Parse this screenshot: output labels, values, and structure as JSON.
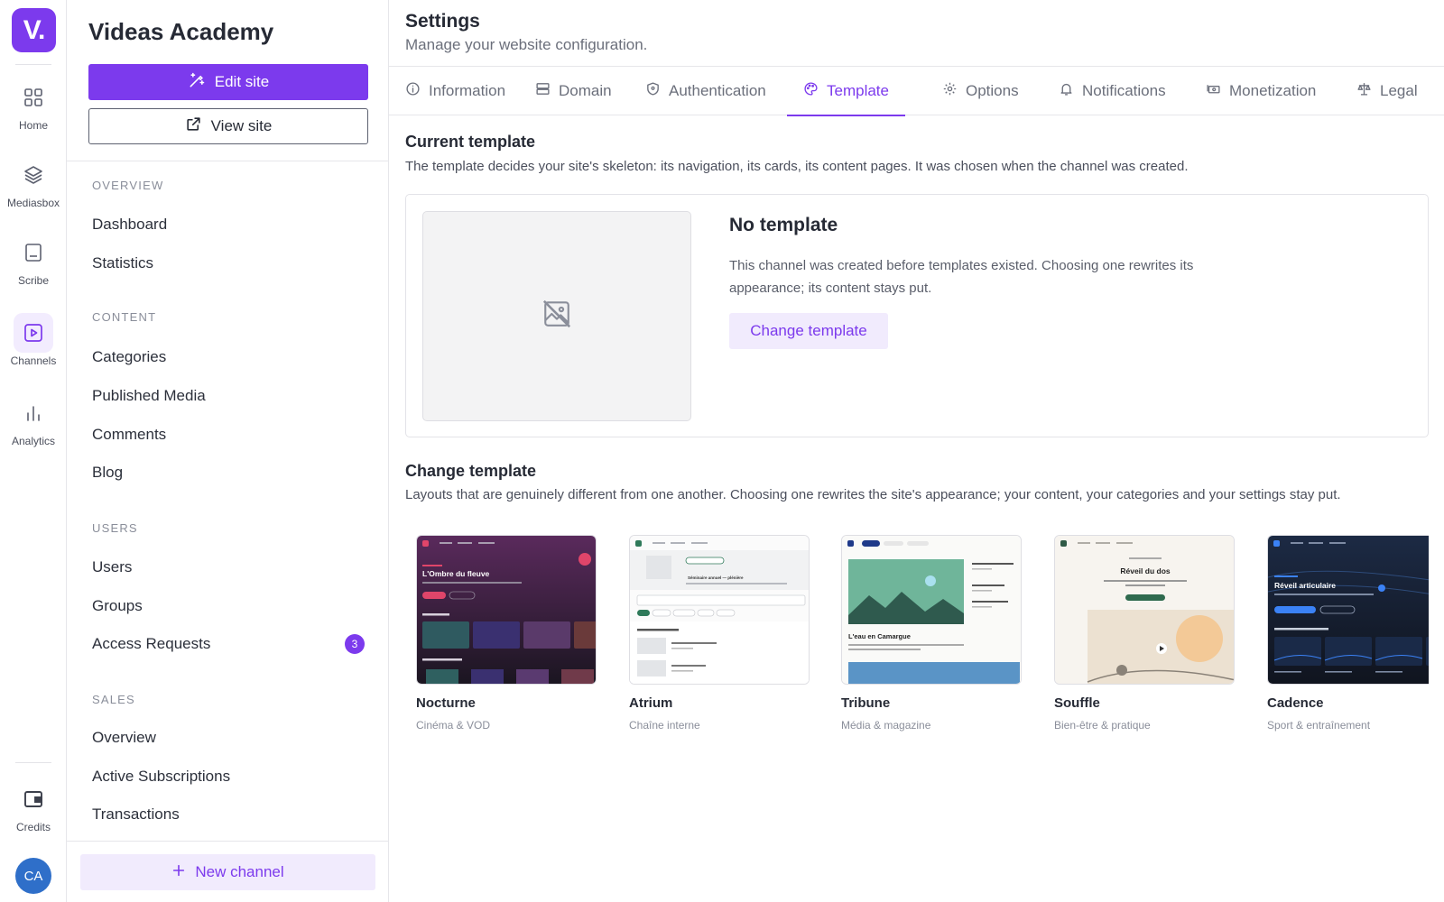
{
  "rail": {
    "logo": "V.",
    "items": [
      {
        "label": "Home",
        "icon": "grid-icon"
      },
      {
        "label": "Mediasbox",
        "icon": "layers-icon"
      },
      {
        "label": "Scribe",
        "icon": "document-icon"
      },
      {
        "label": "Channels",
        "icon": "play-square-icon",
        "active": true
      },
      {
        "label": "Analytics",
        "icon": "bar-chart-icon"
      }
    ],
    "credits_label": "Credits",
    "avatar_initials": "CA"
  },
  "sidebar": {
    "site_title": "Videas Academy",
    "edit_label": "Edit site",
    "view_label": "View site",
    "sections": {
      "overview": {
        "title": "OVERVIEW",
        "items": [
          "Dashboard",
          "Statistics"
        ]
      },
      "content": {
        "title": "CONTENT",
        "items": [
          "Categories",
          "Published Media",
          "Comments",
          "Blog"
        ]
      },
      "users": {
        "title": "USERS",
        "items": [
          "Users",
          "Groups",
          "Access Requests"
        ],
        "access_requests_badge": "3"
      },
      "sales": {
        "title": "SALES",
        "items": [
          "Overview",
          "Active Subscriptions",
          "Transactions"
        ]
      }
    },
    "new_channel_label": "New channel"
  },
  "header": {
    "title": "Settings",
    "subtitle": "Manage your website configuration."
  },
  "tabs": [
    {
      "label": "Information",
      "icon": "info-icon"
    },
    {
      "label": "Domain",
      "icon": "server-icon"
    },
    {
      "label": "Authentication",
      "icon": "shield-icon"
    },
    {
      "label": "Template",
      "icon": "palette-icon",
      "active": true
    },
    {
      "label": "Options",
      "icon": "gear-icon"
    },
    {
      "label": "Notifications",
      "icon": "bell-icon"
    },
    {
      "label": "Monetization",
      "icon": "money-icon"
    },
    {
      "label": "Legal",
      "icon": "scale-icon"
    }
  ],
  "current_template": {
    "title": "Current template",
    "description": "The template decides your site's skeleton: its navigation, its cards, its content pages. It was chosen when the channel was created.",
    "card_title": "No template",
    "card_description": "This channel was created before templates existed. Choosing one rewrites its appearance; its content stays put.",
    "change_button": "Change template"
  },
  "change_template": {
    "title": "Change template",
    "description": "Layouts that are genuinely different from one another. Choosing one rewrites the site's appearance; your content, your categories and your settings stay put.",
    "templates": [
      {
        "name": "Nocturne",
        "category": "Cinéma & VOD",
        "hero": "L'Ombre du fleuve"
      },
      {
        "name": "Atrium",
        "category": "Chaîne interne",
        "hero": "Séminaire annuel — plénière"
      },
      {
        "name": "Tribune",
        "category": "Média & magazine",
        "hero": "L'eau en Camargue"
      },
      {
        "name": "Souffle",
        "category": "Bien-être & pratique",
        "hero": "Réveil du dos"
      },
      {
        "name": "Cadence",
        "category": "Sport & entraînement",
        "hero": "Réveil articulaire"
      }
    ]
  },
  "colors": {
    "accent": "#7c3aed",
    "accent_soft": "#f1ebfd",
    "avatar": "#2f6fc9"
  }
}
